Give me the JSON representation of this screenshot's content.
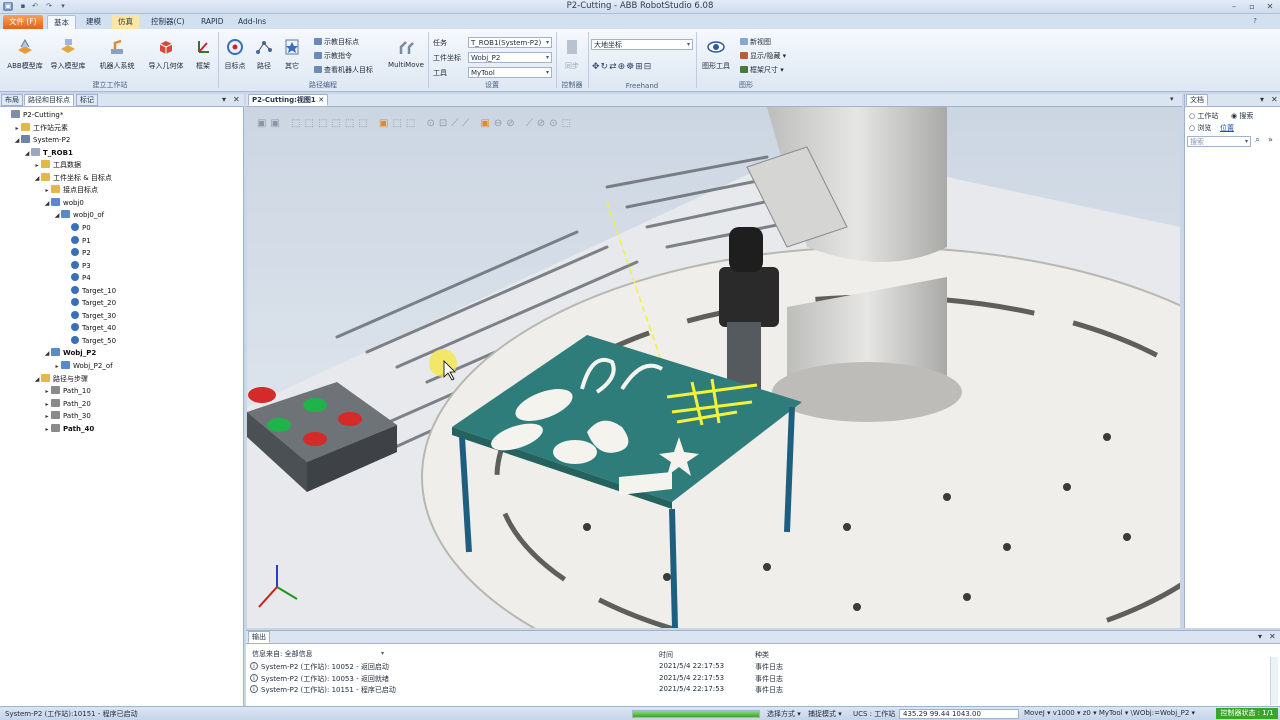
{
  "window": {
    "title": "P2-Cutting - ABB RobotStudio 6.08"
  },
  "tabs": [
    {
      "label": "文件 (F)"
    },
    {
      "label": "基本"
    },
    {
      "label": "建模"
    },
    {
      "label": "仿真"
    },
    {
      "label": "控制器(C)"
    },
    {
      "label": "RAPID"
    },
    {
      "label": "Add-Ins"
    }
  ],
  "ribbon": {
    "build": {
      "abb_library": "ABB模型库",
      "import_library": "导入模型库",
      "robot_system": "机器人系统",
      "import_geometry": "导入几何体",
      "frame": "框架",
      "group": "建立工作站"
    },
    "path": {
      "target": "目标点",
      "path": "路径",
      "other": "其它",
      "teach_target": "示教目标点",
      "teach_instruction": "示教指令",
      "view_targets": "查看机器人目标",
      "multimove": "MultiMove",
      "group": "路径编程"
    },
    "settings": {
      "task_label": "任务",
      "task_value": "T_ROB1(System-P2)",
      "wobj_label": "工件坐标",
      "wobj_value": "Wobj_P2",
      "tool_label": "工具",
      "tool_value": "MyTool",
      "group": "设置"
    },
    "controller": {
      "sync": "同步",
      "group": "控制器"
    },
    "freehand": {
      "frame_value": "大地坐标",
      "group": "Freehand"
    },
    "graphics": {
      "graphics_tools": "图形工具",
      "new_view": "新视图",
      "show_hide": "显示/隐藏",
      "frame_size": "框架尺寸",
      "group": "图形"
    }
  },
  "left_panel": {
    "tabs": [
      "布局",
      "路径和目标点",
      "标记"
    ],
    "tree": [
      {
        "label": "P2-Cutting*",
        "depth": 0,
        "exp": "",
        "bold": false,
        "icon": "station"
      },
      {
        "label": "工作站元素",
        "depth": 1,
        "exp": "▸",
        "bold": false,
        "icon": "folder"
      },
      {
        "label": "System-P2",
        "depth": 1,
        "exp": "◢",
        "bold": false,
        "icon": "system"
      },
      {
        "label": "T_ROB1",
        "depth": 2,
        "exp": "◢",
        "bold": true,
        "icon": "task"
      },
      {
        "label": "工具数据",
        "depth": 3,
        "exp": "▸",
        "bold": false,
        "icon": "folder"
      },
      {
        "label": "工件坐标 & 目标点",
        "depth": 3,
        "exp": "◢",
        "bold": false,
        "icon": "folder"
      },
      {
        "label": "接点目标点",
        "depth": 4,
        "exp": "▸",
        "bold": false,
        "icon": "folder"
      },
      {
        "label": "wobj0",
        "depth": 4,
        "exp": "◢",
        "bold": false,
        "icon": "wobj"
      },
      {
        "label": "wobj0_of",
        "depth": 5,
        "exp": "◢",
        "bold": false,
        "icon": "wobj"
      },
      {
        "label": "P0",
        "depth": 6,
        "exp": "",
        "bold": false,
        "icon": "target"
      },
      {
        "label": "P1",
        "depth": 6,
        "exp": "",
        "bold": false,
        "icon": "target"
      },
      {
        "label": "P2",
        "depth": 6,
        "exp": "",
        "bold": false,
        "icon": "target"
      },
      {
        "label": "P3",
        "depth": 6,
        "exp": "",
        "bold": false,
        "icon": "target"
      },
      {
        "label": "P4",
        "depth": 6,
        "exp": "",
        "bold": false,
        "icon": "target"
      },
      {
        "label": "Target_10",
        "depth": 6,
        "exp": "",
        "bold": false,
        "icon": "target"
      },
      {
        "label": "Target_20",
        "depth": 6,
        "exp": "",
        "bold": false,
        "icon": "target"
      },
      {
        "label": "Target_30",
        "depth": 6,
        "exp": "",
        "bold": false,
        "icon": "target"
      },
      {
        "label": "Target_40",
        "depth": 6,
        "exp": "",
        "bold": false,
        "icon": "target"
      },
      {
        "label": "Target_50",
        "depth": 6,
        "exp": "",
        "bold": false,
        "icon": "target"
      },
      {
        "label": "Wobj_P2",
        "depth": 4,
        "exp": "◢",
        "bold": true,
        "icon": "wobj"
      },
      {
        "label": "Wobj_P2_of",
        "depth": 5,
        "exp": "▸",
        "bold": false,
        "icon": "wobj"
      },
      {
        "label": "路径与步骤",
        "depth": 3,
        "exp": "◢",
        "bold": false,
        "icon": "folder"
      },
      {
        "label": "Path_10",
        "depth": 4,
        "exp": "▸",
        "bold": false,
        "icon": "path"
      },
      {
        "label": "Path_20",
        "depth": 4,
        "exp": "▸",
        "bold": false,
        "icon": "path"
      },
      {
        "label": "Path_30",
        "depth": 4,
        "exp": "▸",
        "bold": false,
        "icon": "path"
      },
      {
        "label": "Path_40",
        "depth": 4,
        "exp": "▸",
        "bold": true,
        "icon": "path"
      }
    ]
  },
  "viewport": {
    "tab_label": "P2-Cutting:视图1"
  },
  "right_panel": {
    "title": "文档",
    "radio_station": "工作站",
    "radio_search": "搜索",
    "radio_browse": "浏览",
    "location_link": "位置",
    "search_placeholder": "搜索"
  },
  "output": {
    "title": "输出",
    "filter_label": "信息来自: 全部信息",
    "col_time": "时间",
    "col_type": "种类",
    "rows": [
      {
        "message": "System-P2 (工作站): 10052 - 返回启动",
        "time": "2021/5/4 22:17:53",
        "type": "事件日志"
      },
      {
        "message": "System-P2 (工作站): 10053 - 返回就绪",
        "time": "2021/5/4 22:17:53",
        "type": "事件日志"
      },
      {
        "message": "System-P2 (工作站): 10151 - 程序已启动",
        "time": "2021/5/4 22:17:53",
        "type": "事件日志"
      }
    ]
  },
  "statusbar": {
    "left": "System-P2 (工作站):10151 - 程序已启动",
    "select_mode": "选择方式 ▾",
    "snap_mode": "捕捉模式 ▾",
    "ucs": "UCS : 工作站",
    "coords": "435.29   99.44   1043.00",
    "motion": "MoveJ ▾  v1000 ▾  z0 ▾  MyTool ▾  \\WObj:=Wobj_P2 ▾",
    "controller_status": "控制器状态 : 1/1"
  },
  "colors": {
    "accent": "#e0651c",
    "table_top": "#2e7d7a",
    "path_highlight": "#f2f23a",
    "robot_body": "#d9d9d7"
  },
  "icons": [
    "save-icon",
    "undo-icon",
    "redo-icon",
    "search-icon",
    "close-icon",
    "pin-icon",
    "target-icon",
    "folder-icon",
    "info-icon"
  ]
}
